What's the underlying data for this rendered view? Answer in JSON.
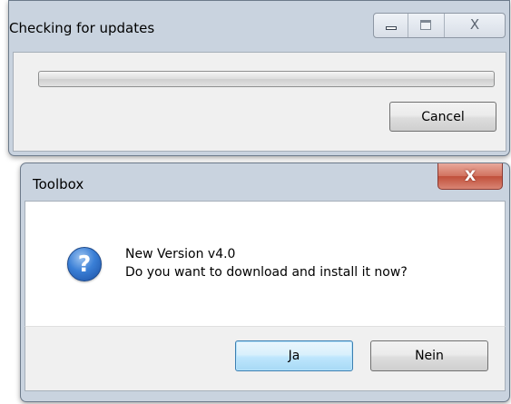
{
  "update_window": {
    "title": "Checking for updates",
    "progress_fraction": 0.0,
    "cancel_label": "Cancel",
    "close_glyph": "X"
  },
  "dialog": {
    "title": "Toolbox",
    "close_glyph": "X",
    "icon_glyph": "?",
    "icon": "question-icon",
    "line1": "New Version v4.0",
    "line2": "Do you want to download and install it now?",
    "yes_label": "Ja",
    "no_label": "Nein"
  },
  "colors": {
    "frame": "#c9d3df",
    "close_accent": "#c04f3a",
    "default_button": "#3c7fb1",
    "icon_blue": "#3a7fd6"
  }
}
